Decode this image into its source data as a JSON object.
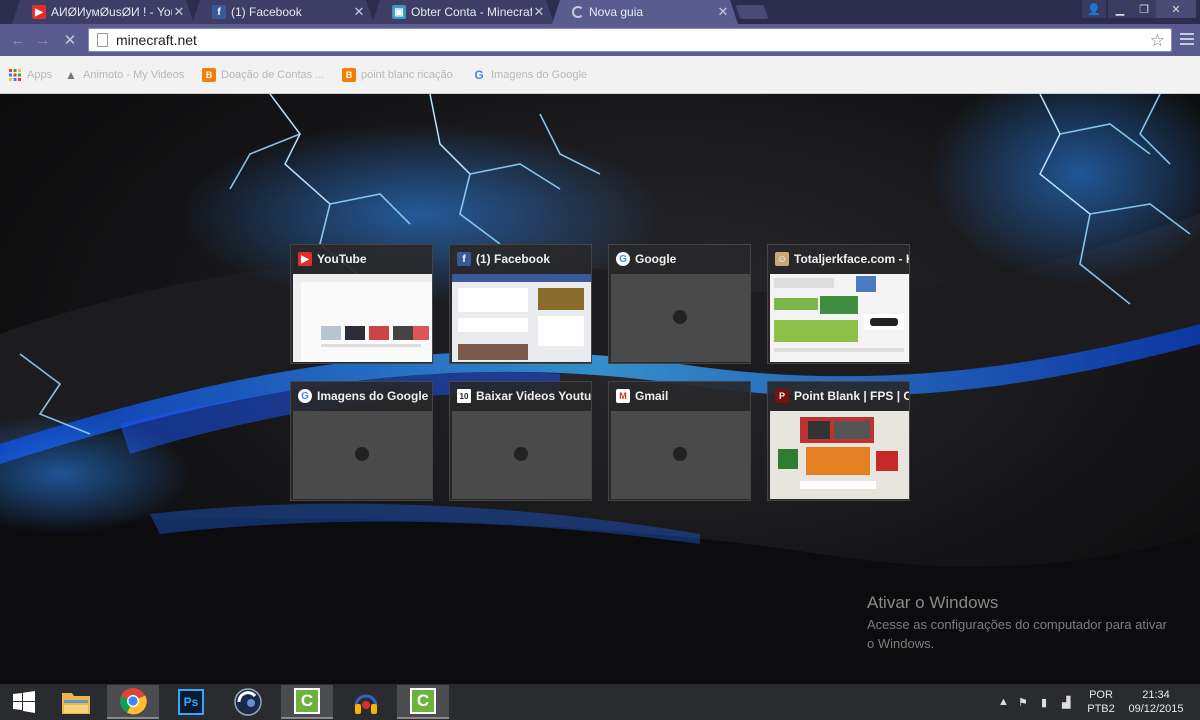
{
  "browser": {
    "tabs": [
      {
        "title": "АИØИумØusØИ ! - YouTube",
        "favicon": "youtube-icon",
        "active": false
      },
      {
        "title": "(1) Facebook",
        "favicon": "facebook-icon",
        "active": false
      },
      {
        "title": "Obter Conta - MinecraftLe",
        "favicon": "gift-icon",
        "active": false
      },
      {
        "title": "Nova guia",
        "favicon": "loading-spinner-icon",
        "active": true
      }
    ],
    "address_bar": {
      "url": "minecraft.net"
    },
    "bookmarks": [
      {
        "label": "Apps",
        "icon": "apps-grid-icon"
      },
      {
        "label": "Animoto - My Videos",
        "icon": "animoto-icon"
      },
      {
        "label": "Doação de Contas ...",
        "icon": "blogger-icon"
      },
      {
        "label": "point blanc ricação",
        "icon": "blogger-icon"
      },
      {
        "label": "Imagens do Google",
        "icon": "google-icon"
      }
    ]
  },
  "most_visited": [
    {
      "title": "YouTube",
      "icon": "youtube-icon",
      "thumbnail": "screenshot"
    },
    {
      "title": "(1) Facebook",
      "icon": "facebook-icon",
      "thumbnail": "screenshot"
    },
    {
      "title": "Google",
      "icon": "google-icon",
      "thumbnail": "placeholder"
    },
    {
      "title": "Totaljerkface.com - H",
      "icon": "totaljerkface-icon",
      "thumbnail": "screenshot"
    },
    {
      "title": "Imagens do Google",
      "icon": "google-icon",
      "thumbnail": "placeholder"
    },
    {
      "title": "Baixar Videos Youtub",
      "icon": "baixar-icon",
      "thumbnail": "placeholder"
    },
    {
      "title": "Gmail",
      "icon": "gmail-icon",
      "thumbnail": "placeholder"
    },
    {
      "title": "Point Blank | FPS | Or",
      "icon": "pointblank-icon",
      "thumbnail": "screenshot"
    }
  ],
  "watermark": {
    "title": "Ativar o Windows",
    "subtitle": "Acesse as configurações do computador para ativar o Windows."
  },
  "taskbar": {
    "items": [
      {
        "name": "start-button",
        "icon": "windows-logo-icon"
      },
      {
        "name": "file-explorer",
        "icon": "folder-icon"
      },
      {
        "name": "chrome",
        "icon": "chrome-icon",
        "active": true
      },
      {
        "name": "photoshop",
        "icon": "photoshop-icon"
      },
      {
        "name": "cinema4d",
        "icon": "cinema4d-icon"
      },
      {
        "name": "camtasia",
        "icon": "camtasia-icon"
      },
      {
        "name": "audio-app",
        "icon": "headphones-icon"
      },
      {
        "name": "camtasia-2",
        "icon": "camtasia-icon",
        "active": true
      }
    ],
    "tray": {
      "language": "POR",
      "keyboard": "PTB2",
      "time": "21:34",
      "date": "09/12/2015"
    }
  },
  "colors": {
    "tab_strip": "#2b2c4e",
    "toolbar": "#5a5c8f",
    "lightning": "#3aa0ff",
    "taskbar": "#2a2b2e"
  }
}
